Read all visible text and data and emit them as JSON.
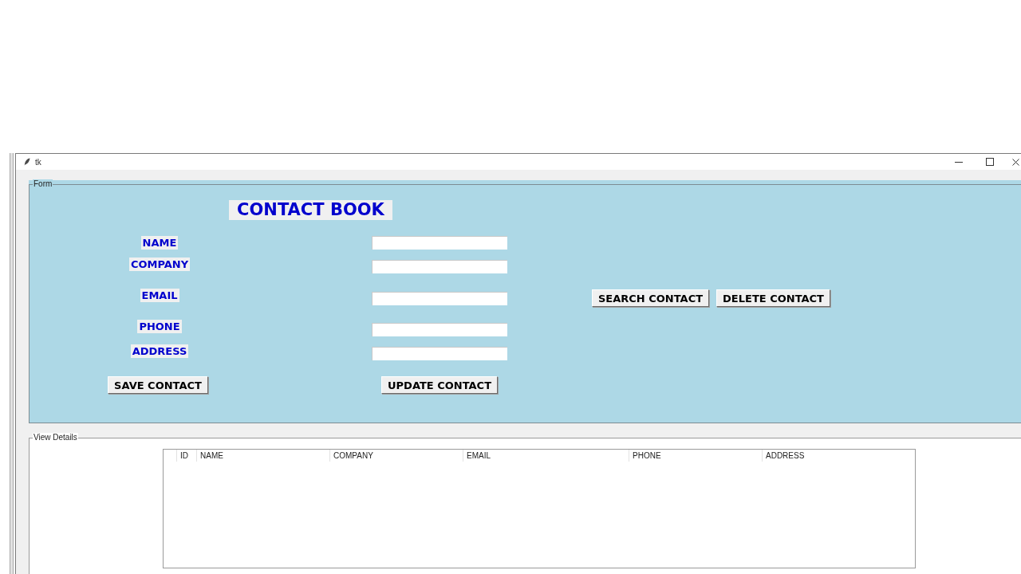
{
  "window": {
    "title": "tk"
  },
  "form": {
    "legend": "Form",
    "heading": "CONTACT BOOK",
    "fields": [
      {
        "label": "NAME"
      },
      {
        "label": "COMPANY"
      },
      {
        "label": "EMAIL"
      },
      {
        "label": "PHONE"
      },
      {
        "label": "ADDRESS"
      }
    ],
    "action_buttons": [
      "SEARCH CONTACT",
      "DELETE CONTACT"
    ],
    "bottom_buttons": [
      "SAVE CONTACT",
      "UPDATE CONTACT"
    ]
  },
  "view_details": {
    "legend": "View Details",
    "table": {
      "columns": [
        "ID",
        "NAME",
        "COMPANY",
        "EMAIL",
        "PHONE",
        "ADDRESS"
      ]
    }
  }
}
